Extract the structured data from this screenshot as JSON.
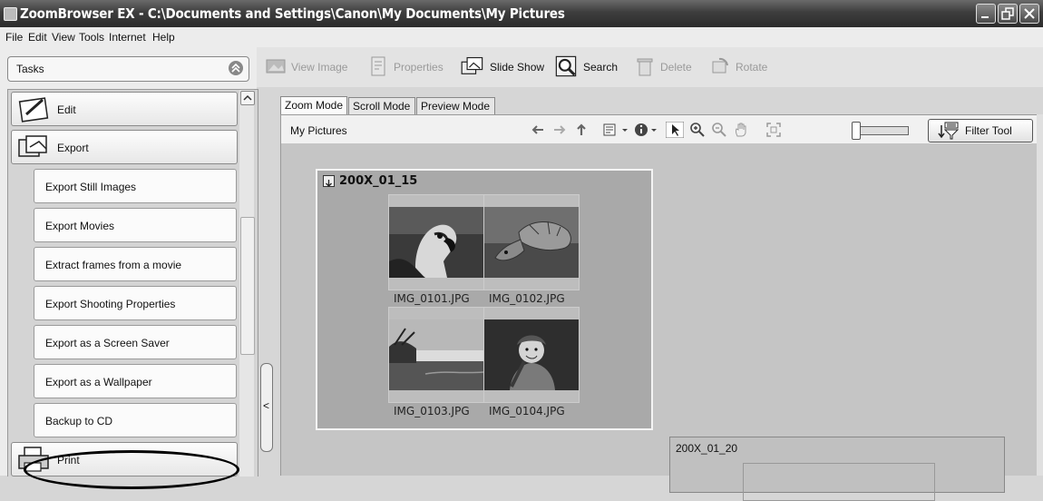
{
  "window": {
    "title": "ZoomBrowser EX  - C:\\Documents and Settings\\Canon\\My Documents\\My Pictures"
  },
  "menu": [
    "File",
    "Edit",
    "View",
    "Tools",
    "Internet",
    "Help"
  ],
  "tasks_header": "Tasks",
  "tasks": {
    "edit": "Edit",
    "export": "Export",
    "print": "Print",
    "export_items": [
      "Export Still Images",
      "Export Movies",
      "Extract frames from a movie",
      "Export Shooting Properties",
      "Export as a Screen Saver",
      "Export as a Wallpaper",
      "Backup to CD"
    ]
  },
  "collapse_glyph": "<",
  "toolbar": {
    "view_image": "View Image",
    "properties": "Properties",
    "slide_show": "Slide Show",
    "search": "Search",
    "delete": "Delete",
    "rotate": "Rotate"
  },
  "tabs": [
    "Zoom Mode",
    "Scroll Mode",
    "Preview Mode"
  ],
  "breadcrumb": "My Pictures",
  "filter_tool": "Filter Tool",
  "group1": {
    "name": "200X_01_15",
    "images": [
      "IMG_0101.JPG",
      "IMG_0102.JPG",
      "IMG_0103.JPG",
      "IMG_0104.JPG"
    ]
  },
  "group2": {
    "name": "200X_01_20"
  }
}
